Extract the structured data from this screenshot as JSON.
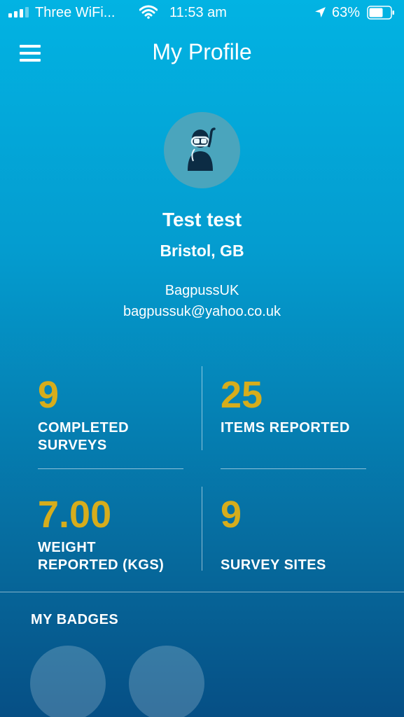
{
  "status_bar": {
    "carrier": "Three WiFi...",
    "time": "11:53 am",
    "battery": "63%"
  },
  "header": {
    "title": "My Profile"
  },
  "profile": {
    "name": "Test test",
    "location": "Bristol, GB",
    "username": "BagpussUK",
    "email": "bagpussuk@yahoo.co.uk"
  },
  "stats": {
    "completed_surveys": {
      "value": "9",
      "label": "COMPLETED\nSURVEYS"
    },
    "items_reported": {
      "value": "25",
      "label": "ITEMS REPORTED"
    },
    "weight_reported": {
      "value": "7.00",
      "label": "WEIGHT\nREPORTED (KGS)"
    },
    "survey_sites": {
      "value": "9",
      "label": "SURVEY SITES"
    }
  },
  "badges": {
    "title": "MY BADGES"
  },
  "colors": {
    "accent": "#d6ad1c",
    "background_top": "#02b3e3",
    "background_bottom": "#064f85",
    "avatar_bg": "#4aa5bd"
  },
  "icons": {
    "menu": "hamburger-menu-icon",
    "avatar": "scuba-diver-icon",
    "wifi": "wifi-icon",
    "location": "location-arrow-icon",
    "battery": "battery-icon"
  }
}
